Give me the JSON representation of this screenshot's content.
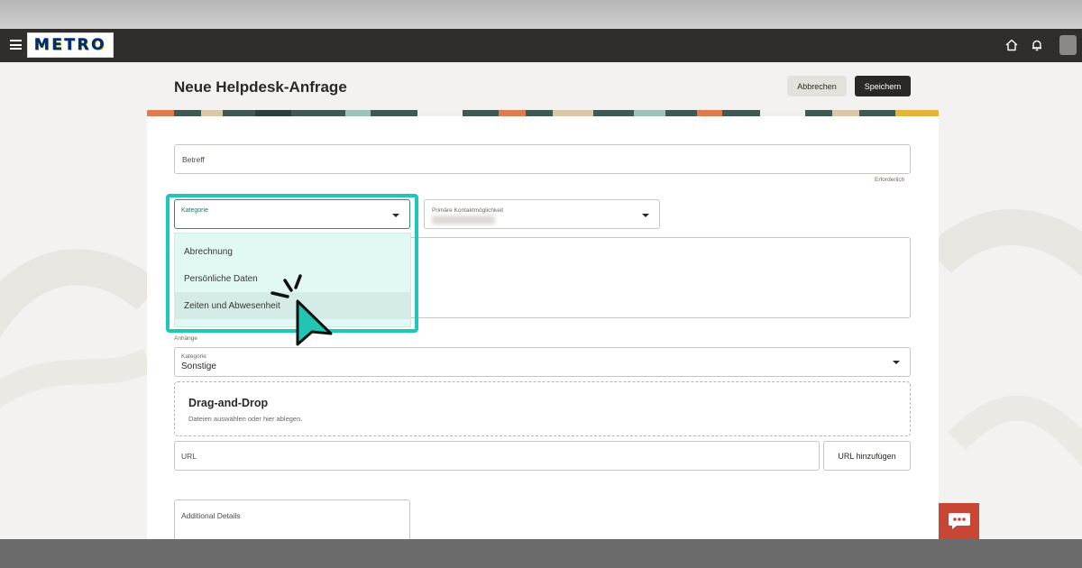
{
  "header": {
    "logo_text": "METRO",
    "menu_icon": "hamburger-icon",
    "home_icon": "home-icon",
    "bell_icon": "bell-icon"
  },
  "page": {
    "title": "Neue Helpdesk-Anfrage",
    "cancel_label": "Abbrechen",
    "save_label": "Speichern"
  },
  "form": {
    "subject_label": "Betreff",
    "subject_required": "Erforderlich",
    "category_label": "Kategorie",
    "category_options": [
      "Abrechnung",
      "Persönliche Daten",
      "Zeiten und Abwesenheit"
    ],
    "category_hovered": "Zeiten und Abwesenheit",
    "contact_label": "Primäre Kontaktmöglichkeit",
    "attachments_title": "Anhänge",
    "attachment_category_label": "Kategorie",
    "attachment_category_value": "Sonstige",
    "dropzone_title": "Drag-and-Drop",
    "dropzone_subtitle": "Dateien auswählen oder hier ablegen.",
    "url_placeholder": "URL",
    "url_button": "URL hinzufügen",
    "details_label": "Additional Details"
  },
  "colors": {
    "accent": "#1ec8b6",
    "dropdown_bg": "#e2f8f4",
    "navbar": "#312d2a",
    "chat": "#c74634"
  },
  "chat_icon": "chat-icon"
}
